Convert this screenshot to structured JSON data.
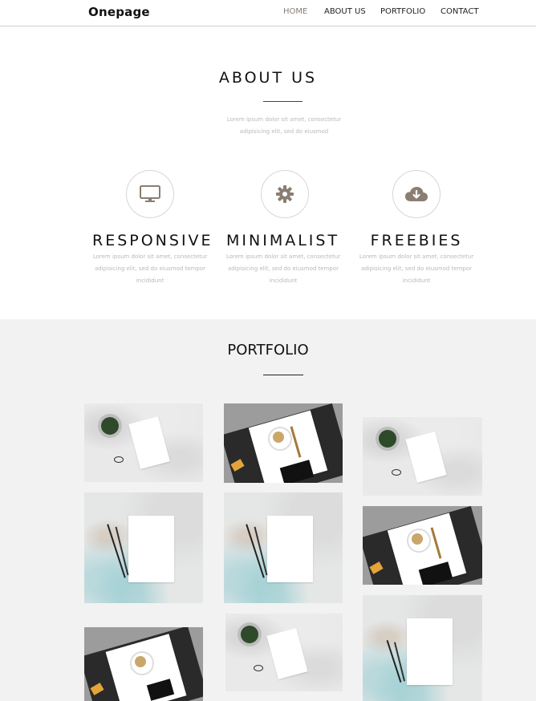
{
  "nav": {
    "brand": "Onepage",
    "items": [
      "HOME",
      "ABOUT US",
      "PORTFOLIO",
      "CONTACT"
    ]
  },
  "about": {
    "title": "ABOUT US",
    "intro_line1": "Lorem ipsum dolor sit amet, consectetur",
    "intro_line2": "adipisicing elit, sed do eiusmod",
    "features": [
      {
        "icon": "monitor-icon",
        "title": "RESPONSIVE",
        "line1": "Lorem ipsum dolor sit amet, consectetur",
        "line2": "adipisicing elit, sed do eiusmod tempor",
        "line3": "incididunt"
      },
      {
        "icon": "gear-icon",
        "title": "MINIMALIST",
        "line1": "Lorem ipsum dolor sit amet, consectetur",
        "line2": "adipisicing elit, sed do eiusmod tempor",
        "line3": "incididunt"
      },
      {
        "icon": "cloud-download-icon",
        "title": "FREEBIES",
        "line1": "Lorem ipsum dolor sit amet, consectetur",
        "line2": "adipisicing elit, sed do eiusmod tempor",
        "line3": "incididunt"
      }
    ]
  },
  "portfolio": {
    "title": "PORTFOLIO"
  },
  "colors": {
    "accent": "#8a7e72",
    "icon": "#8a7e72",
    "portfolio_bg": "#f2f2f2"
  }
}
